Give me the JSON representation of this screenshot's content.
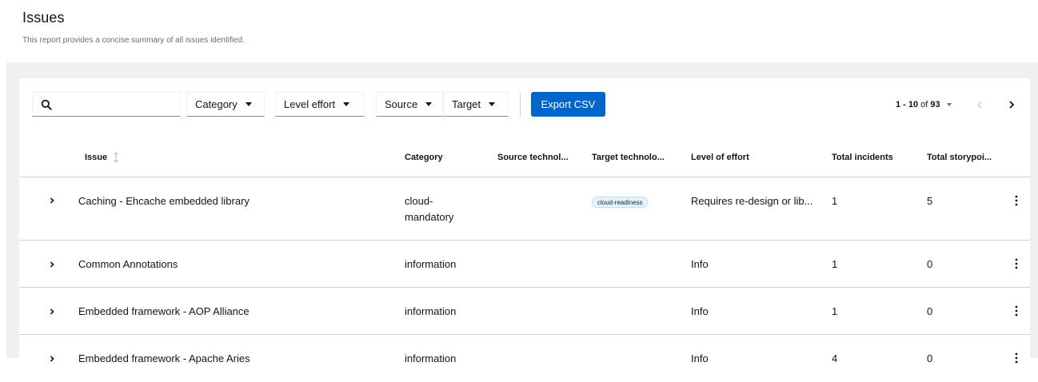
{
  "header": {
    "title": "Issues",
    "description": "This report provides a concise summary of all issues identified."
  },
  "toolbar": {
    "search_value": "",
    "category_label": "Category",
    "effort_label": "Level effort",
    "source_label": "Source",
    "target_label": "Target",
    "export_label": "Export CSV"
  },
  "pagination": {
    "range": "1 - 10",
    "of_label": "of",
    "total": "93"
  },
  "table": {
    "columns": {
      "issue": "Issue",
      "category": "Category",
      "source": "Source technol...",
      "target": "Target technolo...",
      "effort": "Level of effort",
      "incidents": "Total incidents",
      "storypoints": "Total storypoi..."
    },
    "rows": [
      {
        "issue": "Caching - Ehcache embedded library",
        "category_line1": "cloud-",
        "category_line2": "mandatory",
        "source": "",
        "target_label": "cloud-readiness",
        "effort": "Requires re-design or lib...",
        "incidents": "1",
        "storypoints": "5"
      },
      {
        "issue": "Common Annotations",
        "category": "information",
        "source": "",
        "effort": "Info",
        "incidents": "1",
        "storypoints": "0"
      },
      {
        "issue": "Embedded framework - AOP Alliance",
        "category": "information",
        "source": "",
        "effort": "Info",
        "incidents": "1",
        "storypoints": "0"
      },
      {
        "issue": "Embedded framework - Apache Aries",
        "category": "information",
        "source": "",
        "effort": "Info",
        "incidents": "4",
        "storypoints": "0"
      }
    ]
  },
  "icons": {
    "search": "search-icon",
    "caret": "caret-down-icon",
    "prev": "angle-left-icon",
    "next": "angle-right-icon",
    "expand": "angle-right-icon",
    "kebab": "ellipsis-vertical-icon",
    "sort": "sort-icon"
  },
  "colors": {
    "primary": "#0066cc",
    "background": "#f0f0f0",
    "border": "#d2d2d2",
    "muted": "#6a6e73"
  }
}
